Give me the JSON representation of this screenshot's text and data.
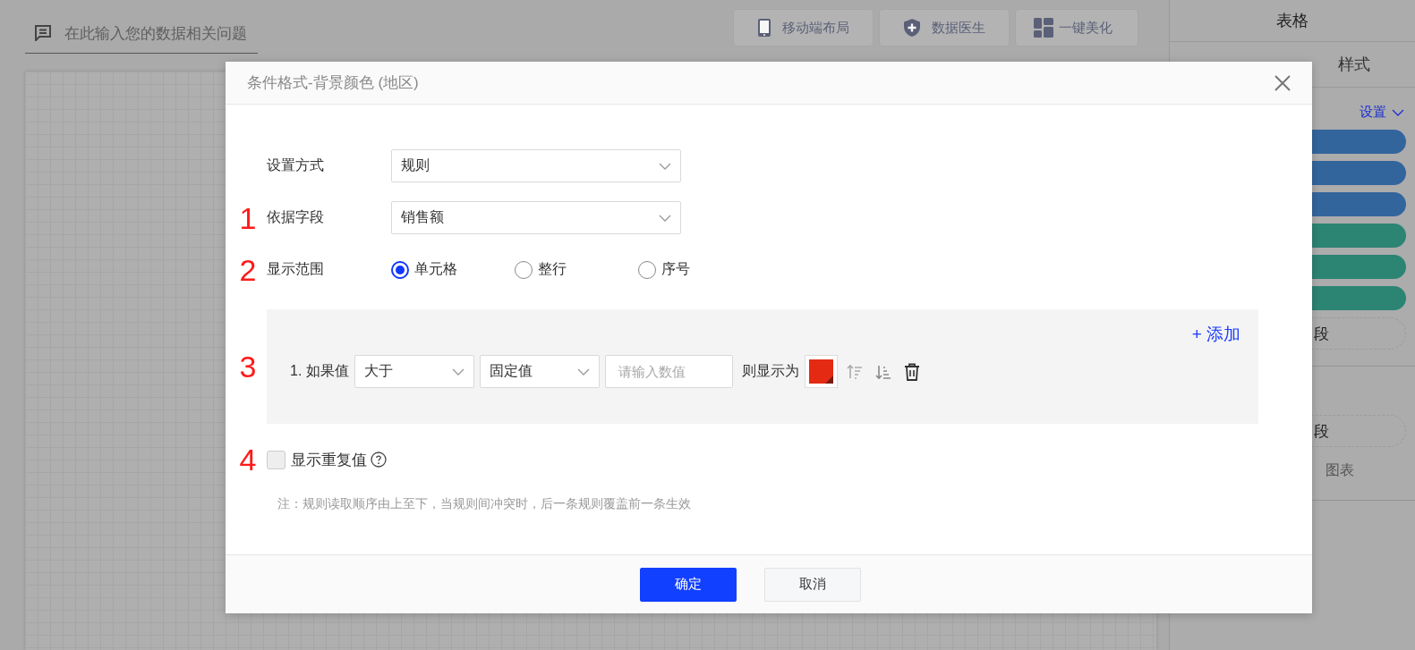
{
  "search": {
    "placeholder": "在此输入您的数据相关问题"
  },
  "toolbar": [
    {
      "label": "移动端布局"
    },
    {
      "label": "数据医生"
    },
    {
      "label": "一键美化"
    }
  ],
  "side_panel": {
    "title": "表格",
    "tabs": [
      {
        "label": "样式"
      }
    ],
    "settings_link": "设置",
    "field_pills": [
      {
        "color": "#33659d"
      },
      {
        "color": "#33659d"
      },
      {
        "color": "#33659d"
      },
      {
        "color": "#2c8473"
      },
      {
        "color": "#2c8473"
      },
      {
        "color": "#2c8473"
      }
    ],
    "drop_zones": [
      {
        "label": "段"
      },
      {
        "label": "段"
      }
    ],
    "hint": "图表"
  },
  "dialog": {
    "title": "条件格式-背景颜色 (地区)",
    "fields": [
      {
        "label": "设置方式",
        "value": "规则"
      },
      {
        "label": "依据字段",
        "value": "销售额",
        "marker": "1"
      }
    ],
    "scope": {
      "marker": "2",
      "label": "显示范围",
      "options": [
        {
          "label": "单元格",
          "selected": true
        },
        {
          "label": "整行",
          "selected": false
        },
        {
          "label": "序号",
          "selected": false
        }
      ]
    },
    "rules_panel": {
      "marker": "3",
      "add_link": "+ 添加",
      "rules": [
        {
          "index": "1.",
          "prefix": "如果值",
          "operator": "大于",
          "value_type": "固定值",
          "value_placeholder": "请输入数值",
          "result_label": "则显示为",
          "color": "#e52a14"
        }
      ]
    },
    "show_duplicates": {
      "marker": "4",
      "label": "显示重复值",
      "checked": false
    },
    "note": "注：规则读取顺序由上至下，当规则间冲突时，后一条规则覆盖前一条生效",
    "buttons": [
      {
        "label": "确定",
        "kind": "primary"
      },
      {
        "label": "取消",
        "kind": "secondary"
      }
    ]
  }
}
